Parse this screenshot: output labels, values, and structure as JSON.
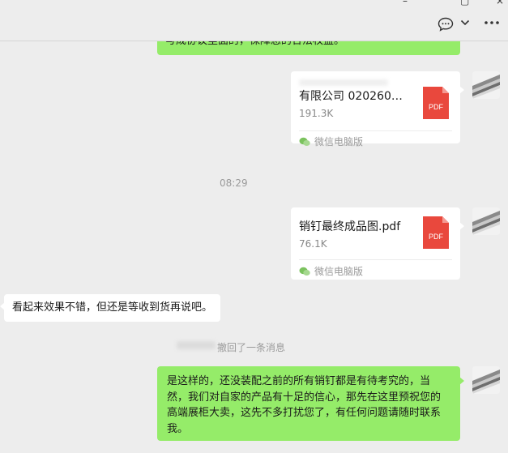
{
  "header": {
    "min_glyph": "–",
    "close_glyph": "×"
  },
  "messages": {
    "top_bubble_partial": "写成协议里面的，保障您的合法权益。",
    "file1": {
      "name": "有限公司  020260…",
      "size": "191.3K",
      "source": "微信电脑版"
    },
    "time": "08:29",
    "file2": {
      "name": "销钉最终成品图.pdf",
      "size": "76.1K",
      "source": "微信电脑版"
    },
    "incoming": "看起来效果不错，但还是等收到货再说吧。",
    "recall_notice": "撤回了一条消息",
    "outgoing": "是这样的，还没装配之前的所有销钉都是有待考究的，当然，我们对自家的产品有十足的信心，那先在这里预祝您的高端展柜大卖，这先不多打扰您了，有任何问题请随时联系我。"
  },
  "colors": {
    "bg": "#ededed",
    "sent_bubble": "#95ec69",
    "received_bubble": "#ffffff",
    "pdf_red": "#e9483d",
    "wechat_green": "#7bc25e"
  },
  "icons": [
    "chat-bubble-icon",
    "chevron-down-icon",
    "more-icon",
    "pdf-file-icon",
    "wechat-logo-icon"
  ]
}
